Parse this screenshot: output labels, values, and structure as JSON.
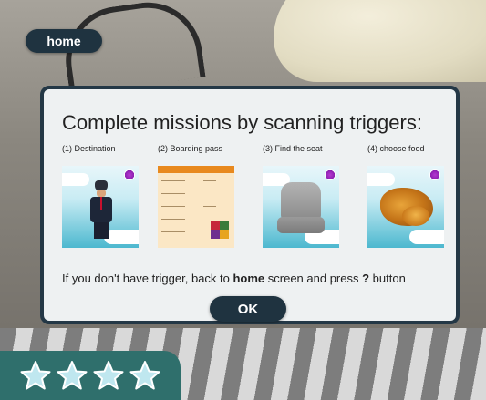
{
  "home_button": {
    "label": "home"
  },
  "dialog": {
    "title": "Complete missions by scanning triggers:",
    "missions": [
      {
        "label": "(1) Destination",
        "icon": "pilot-icon"
      },
      {
        "label": "(2) Boarding pass",
        "icon": "boarding-pass-icon"
      },
      {
        "label": "(3) Find the seat",
        "icon": "seat-icon"
      },
      {
        "label": "(4) choose food",
        "icon": "food-icon"
      }
    ],
    "note": {
      "part1": "If you don't have trigger, back to ",
      "home_word": "home",
      "part2": " screen and press ",
      "question": "?",
      "part3": " button"
    },
    "ok_label": "OK"
  },
  "stars": {
    "count": 4,
    "filled": 0,
    "icon": "star-outline-icon"
  },
  "colors": {
    "button_bg": "#1f3340",
    "panel_bg": "#eef1f2",
    "stars_bar_bg": "#2f6f6c",
    "star_fill": "#bfe7ef"
  }
}
